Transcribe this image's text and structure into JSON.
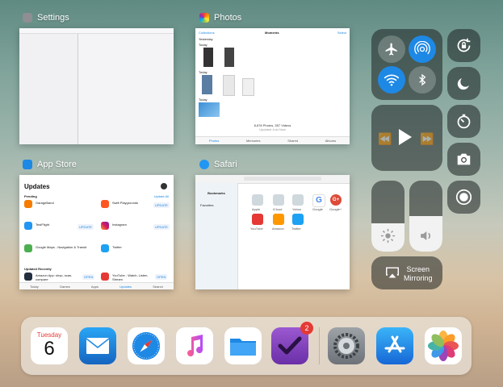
{
  "switcher": {
    "cards": [
      {
        "name": "Settings"
      },
      {
        "name": "Photos"
      },
      {
        "name": "App Store"
      },
      {
        "name": "Safari"
      }
    ]
  },
  "photos_snapshot": {
    "back_label": "Collections",
    "title": "Moments",
    "select_label": "Select",
    "section_header": "Yesterday",
    "group_labels": [
      "Today",
      "Today",
      "Today"
    ],
    "footer_count": "8,678 Photos, 357 Videos",
    "footer_sub": "Updated Just Now",
    "tabs": [
      "Photos",
      "Memories",
      "Shared",
      "Albums"
    ]
  },
  "appstore_snapshot": {
    "title": "Updates",
    "pending_header": "Pending",
    "update_all_label": "Update All",
    "apps_left": [
      "GarageBand",
      "TestFlight",
      "Google Maps - Navigation & Transit"
    ],
    "apps_right": [
      "Swift Playgrounds",
      "Instagram",
      "Twitter"
    ],
    "update_button": "UPDATE",
    "recent_header": "Updated Recently",
    "recent_left": "Amazon App: shop, scan, compare",
    "recent_right": "YouTube - Watch, Listen, Stream",
    "open_button": "OPEN",
    "tabs": [
      "Today",
      "Games",
      "Apps",
      "Updates",
      "Search"
    ]
  },
  "safari_snapshot": {
    "sidebar_title": "Bookmarks",
    "sidebar_item": "Favorites",
    "favorites": [
      "Apple",
      "iCloud",
      "Yahoo",
      "Google",
      "Google+",
      "YouTube",
      "Amazon",
      "Twitter"
    ]
  },
  "control_center": {
    "connectivity": {
      "airplane_mode": false,
      "airdrop": true,
      "wifi": true,
      "bluetooth": false
    },
    "media": {
      "playing": false
    },
    "brightness_level": 0.4,
    "volume_level": 0.5,
    "screen_mirroring": {
      "line1": "Screen",
      "line2": "Mirroring"
    },
    "accent_color": "#1e88e5"
  },
  "dock": {
    "calendar": {
      "weekday": "Tuesday",
      "day": "6"
    },
    "apps": [
      "Calendar",
      "Mail",
      "Safari",
      "Music",
      "Files",
      "OmniFocus",
      "Settings",
      "App Store",
      "Photos"
    ],
    "omnifocus_badge": "2"
  }
}
